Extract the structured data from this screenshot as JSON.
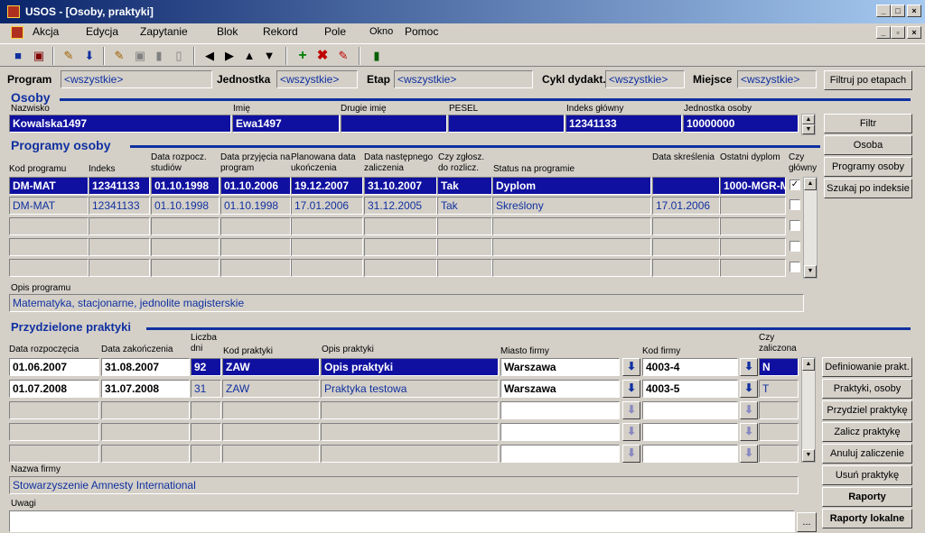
{
  "window": {
    "title": "USOS - [Osoby, praktyki]",
    "buttons": [
      "_",
      "□",
      "×"
    ],
    "inner_buttons": [
      "_",
      "▫",
      "×"
    ]
  },
  "menu": [
    "Akcja",
    "Edycja",
    "Zapytanie",
    "Blok",
    "Rekord",
    "Pole",
    "Okno",
    "Pomoc"
  ],
  "toolbar_icons": [
    "save-icon",
    "print-icon",
    "edit-icon",
    "download-icon",
    "query-icon",
    "execute-icon",
    "count-icon",
    "chart-icon",
    "prev-block-icon",
    "next-block-icon",
    "prev-record-icon",
    "next-record-icon",
    "insert-record-icon",
    "delete-record-icon",
    "clear-icon",
    "exit-icon"
  ],
  "filters": {
    "program_label": "Program",
    "program_value": "<wszystkie>",
    "jednostka_label": "Jednostka",
    "jednostka_value": "<wszystkie>",
    "etap_label": "Etap",
    "etap_value": "<wszystkie>",
    "cykl_label": "Cykl dydakt.",
    "cykl_value": "<wszystkie>",
    "miejsce_label": "Miejsce",
    "miejsce_value": "<wszystkie>",
    "filter_button": "Filtruj po etapach"
  },
  "osoby": {
    "title": "Osoby",
    "labels": [
      "Nazwisko",
      "Imię",
      "Drugie imię",
      "PESEL",
      "Indeks główny",
      "Jednostka osoby"
    ],
    "values": [
      "Kowalska1497",
      "Ewa1497",
      "",
      "",
      "12341133",
      "10000000"
    ]
  },
  "programy": {
    "title": "Programy osoby",
    "headers": [
      "Kod programu",
      "Indeks",
      "Data rozpocz. studiów",
      "Data przyjęcia na program",
      "Planowana data ukończenia",
      "Data następnego zaliczenia",
      "Czy zgłosz. do rozlicz.",
      "Status na programie",
      "Data skreślenia",
      "Ostatni dyplom",
      "Czy główny"
    ],
    "rows": [
      [
        "DM-MAT",
        "12341133",
        "01.10.1998",
        "01.10.2006",
        "19.12.2007",
        "31.10.2007",
        "Tak",
        "Dyplom",
        "",
        "1000-MGR-M",
        "✓"
      ],
      [
        "DM-MAT",
        "12341133",
        "01.10.1998",
        "01.10.1998",
        "17.01.2006",
        "31.12.2005",
        "Tak",
        "Skreślony",
        "17.01.2006",
        "",
        ""
      ],
      [
        "",
        "",
        "",
        "",
        "",
        "",
        "",
        "",
        "",
        "",
        ""
      ],
      [
        "",
        "",
        "",
        "",
        "",
        "",
        "",
        "",
        "",
        "",
        ""
      ],
      [
        "",
        "",
        "",
        "",
        "",
        "",
        "",
        "",
        "",
        "",
        ""
      ]
    ],
    "opis_label": "Opis programu",
    "opis_value": "Matematyka, stacjonarne, jednolite magisterskie"
  },
  "praktyki": {
    "title": "Przydzielone praktyki",
    "headers": [
      "Data rozpoczęcia",
      "Data zakończenia",
      "Liczba dni",
      "Kod praktyki",
      "Opis praktyki",
      "Miasto firmy",
      "Kod firmy",
      "Czy zaliczona"
    ],
    "rows": [
      [
        "01.06.2007",
        "31.08.2007",
        "92",
        "ZAW",
        "Opis praktyki",
        "Warszawa",
        "4003-4",
        "N"
      ],
      [
        "01.07.2008",
        "31.07.2008",
        "31",
        "ZAW",
        "Praktyka testowa",
        "Warszawa",
        "4003-5",
        "T"
      ],
      [
        "",
        "",
        "",
        "",
        "",
        "",
        "",
        ""
      ],
      [
        "",
        "",
        "",
        "",
        "",
        "",
        "",
        ""
      ],
      [
        "",
        "",
        "",
        "",
        "",
        "",
        "",
        ""
      ]
    ],
    "nazwa_label": "Nazwa firmy",
    "nazwa_value": "Stowarzyszenie Amnesty International",
    "uwagi_label": "Uwagi",
    "uwagi_value": "",
    "ellipsis": "..."
  },
  "side_buttons": {
    "filtr": "Filtr",
    "osoba": "Osoba",
    "programy_osoby": "Programy osoby",
    "szukaj": "Szukaj po indeksie",
    "definiowanie": "Definiowanie prakt.",
    "praktyki_osoby": "Praktyki, osoby",
    "przydziel": "Przydziel praktykę",
    "zalicz": "Zalicz praktykę",
    "anuluj": "Anuluj zaliczenie",
    "usun": "Usuń praktykę",
    "raporty": "Raporty",
    "raporty_lokalne": "Raporty lokalne"
  },
  "colors": {
    "selected": "#1010a0",
    "text_blue": "#1030a0",
    "chrome": "#d4d0c8"
  }
}
